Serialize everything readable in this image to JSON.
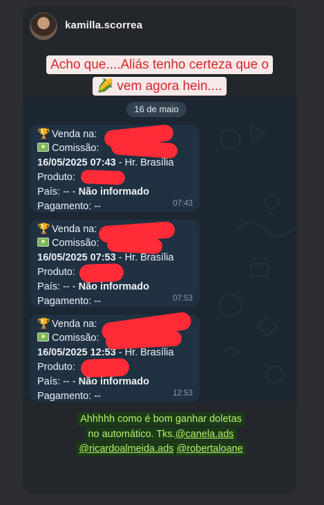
{
  "story": {
    "username": "kamilla.scorrea",
    "caption_top": "Acho que....Aliás tenho certeza que o 🌽 vem agora hein....",
    "caption_bottom_1": "Ahhhhh como é bom ganhar doletas",
    "caption_bottom_2": "no automático. Tks.",
    "mention_1": "@canela.ads",
    "mention_2": "@ricardoalmeida.ads",
    "mention_3": "@robertaloane",
    "highlight_top_color": "#f7e9e9",
    "caption_top_color": "#d4262a",
    "caption_bottom_color": "#b4f270"
  },
  "chat": {
    "date_label": "16 de maio",
    "messages": [
      {
        "sale_label": "Venda na:",
        "commission_label": "Comissão:",
        "datetime": "16/05/2025 07:43",
        "tz": " - Hr. Brasília",
        "product_label": "Produto:",
        "country_label": "País: -- - ",
        "country_value": "Não informado",
        "payment": "Pagamento: --",
        "time": "07:43"
      },
      {
        "sale_label": "Venda na:",
        "commission_label": "Comissão:",
        "datetime": "16/05/2025 07:53",
        "tz": " - Hr. Brasília",
        "product_label": "Produto:",
        "country_label": "País: -- - ",
        "country_value": "Não informado",
        "payment": "Pagamento: --",
        "time": "07:53"
      },
      {
        "sale_label": "Venda na:",
        "commission_label": "Comissão:",
        "datetime": "16/05/2025 12:53",
        "tz": " - Hr. Brasília",
        "product_label": "Produto:",
        "country_label": "País: -- - ",
        "country_value": "Não informado",
        "payment": "Pagamento: --",
        "time": "12:53"
      }
    ]
  },
  "icons": {
    "sale": "trophy-icon",
    "commission": "money-icon"
  },
  "colors": {
    "redaction": "#ff2b37",
    "bubble": "#203142"
  }
}
